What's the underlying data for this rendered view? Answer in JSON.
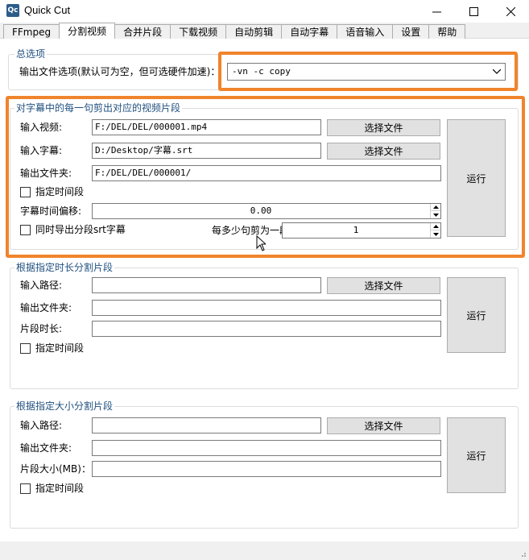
{
  "window": {
    "title": "Quick Cut",
    "app_icon": "Qc"
  },
  "tabs": [
    "FFmpeg",
    "分割视频",
    "合并片段",
    "下载视频",
    "自动剪辑",
    "自动字幕",
    "语音输入",
    "设置",
    "帮助"
  ],
  "general": {
    "title": "总选项",
    "output_label": "输出文件选项(默认可为空，但可选硬件加速)：",
    "output_value": "-vn -c copy"
  },
  "subtitle_split": {
    "title": "对字幕中的每一句剪出对应的视频片段",
    "input_video_label": "输入视频:",
    "input_video_value": "F:/DEL/DEL/000001.mp4",
    "input_subtitle_label": "输入字幕:",
    "input_subtitle_value": "D:/Desktop/字幕.srt",
    "output_folder_label": "输出文件夹:",
    "output_folder_value": "F:/DEL/DEL/000001/",
    "select_file_label": "选择文件",
    "time_range_label": "指定时间段",
    "offset_label": "字幕时间偏移:",
    "offset_value": "0.00",
    "export_srt_label": "同时导出分段srt字幕",
    "per_segment_label": "每多少句剪为一段:",
    "per_segment_value": "1",
    "run_label": "运行"
  },
  "duration_split": {
    "title": "根据指定时长分割片段",
    "input_path_label": "输入路径:",
    "output_folder_label": "输出文件夹:",
    "segment_length_label": "片段时长:",
    "select_file_label": "选择文件",
    "time_range_label": "指定时间段",
    "run_label": "运行"
  },
  "size_split": {
    "title": "根据指定大小分割片段",
    "input_path_label": "输入路径:",
    "output_folder_label": "输出文件夹:",
    "segment_size_label": "片段大小(MB)：",
    "select_file_label": "选择文件",
    "time_range_label": "指定时间段",
    "run_label": "运行"
  },
  "colors": {
    "highlight": "#f0842c",
    "group_title": "#1f4f7f"
  }
}
